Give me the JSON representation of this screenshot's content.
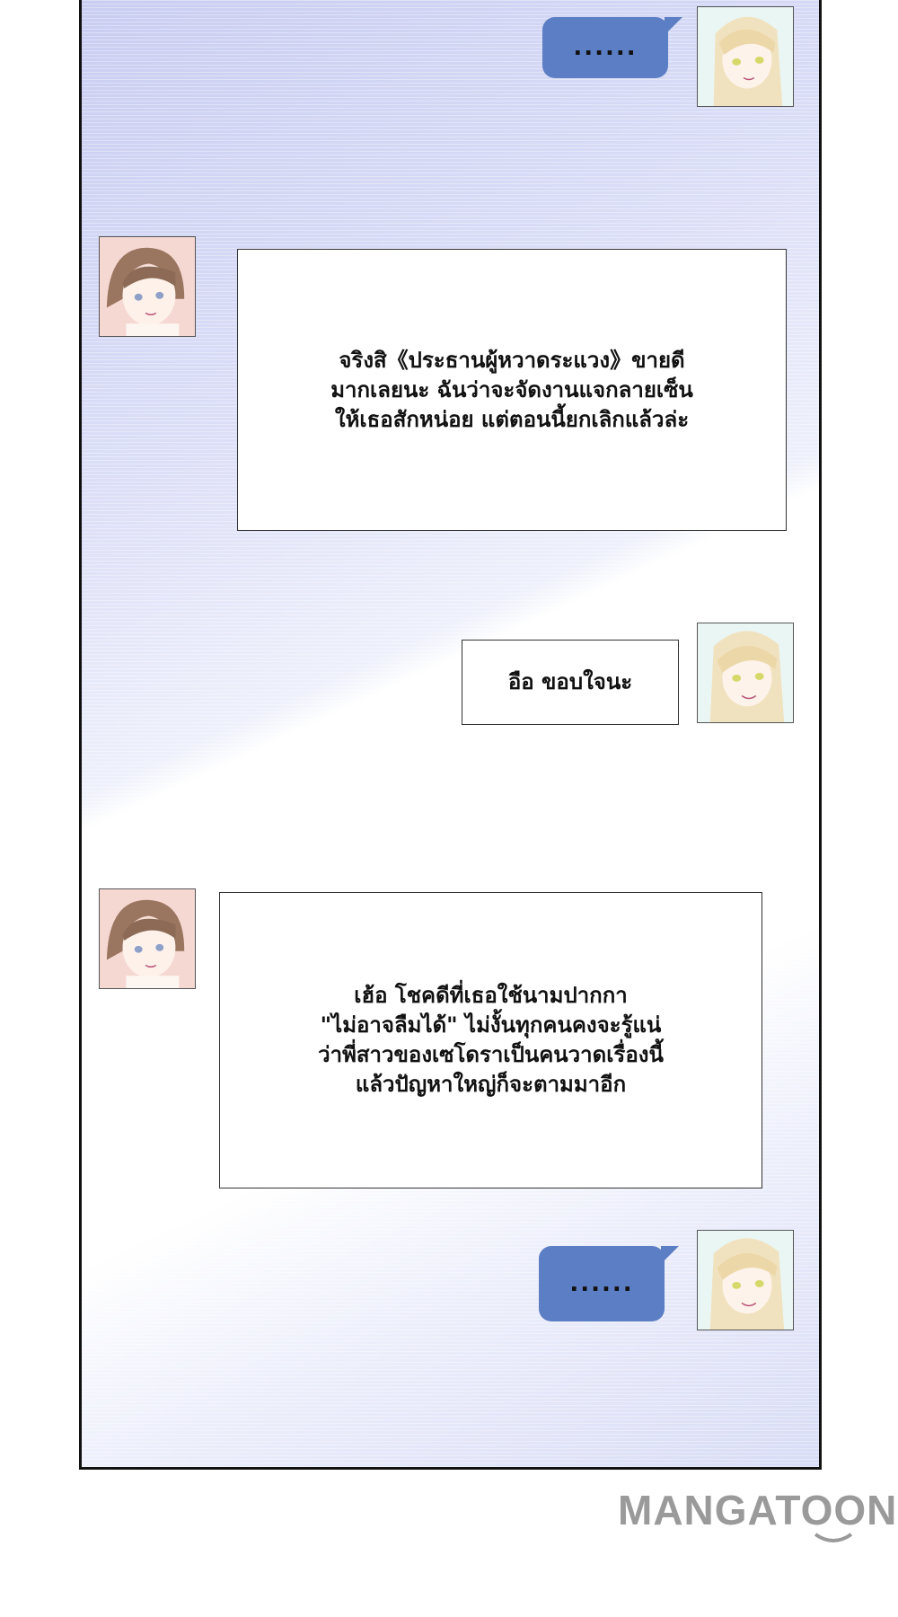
{
  "messages": [
    {
      "sender": "blonde",
      "text": "......"
    },
    {
      "sender": "brunette",
      "text": "จริงสิ《ประธานผู้หวาดระแวง》ขายดี\nมากเลยนะ ฉันว่าจะจัดงานแจกลายเซ็น\nให้เธอสักหน่อย แต่ตอนนี้ยกเลิกแล้วล่ะ"
    },
    {
      "sender": "blonde",
      "text": "อือ ขอบใจนะ"
    },
    {
      "sender": "brunette",
      "text": "เฮ้อ โชคดีที่เธอใช้นามปากกา\n\"ไม่อาจลืมได้\" ไม่งั้นทุกคนคงจะรู้แน่\nว่าพี่สาวของเซโดราเป็นคนวาดเรื่องนี้\nแล้วปัญหาใหญ่ก็จะตามมาอีก"
    },
    {
      "sender": "blonde",
      "text": "......"
    }
  ],
  "watermark": {
    "text": "MANGATOON"
  }
}
